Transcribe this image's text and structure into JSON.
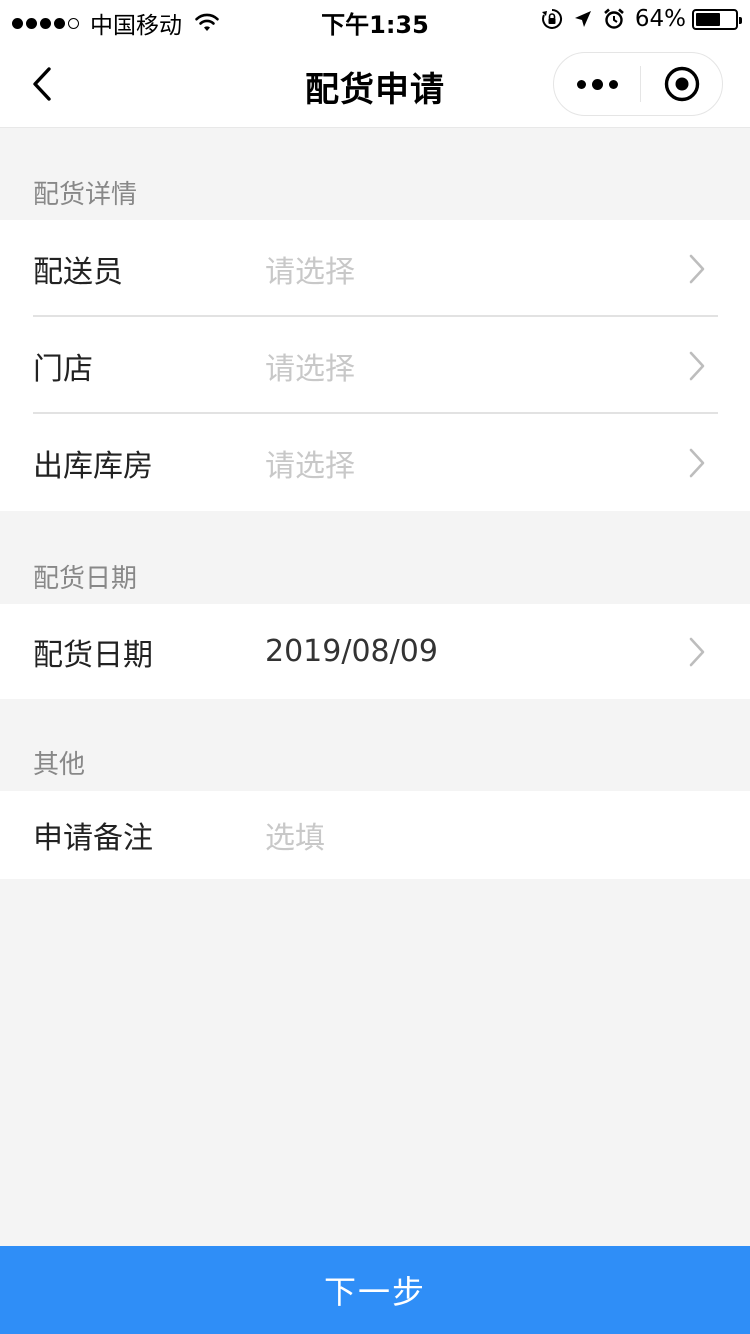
{
  "status_bar": {
    "carrier": "中国移动",
    "time": "下午1:35",
    "battery_percent": "64%",
    "battery_level": 0.64,
    "icons": [
      "signal-icon",
      "wifi-icon",
      "rotation-lock-icon",
      "location-icon",
      "alarm-icon",
      "battery-icon"
    ]
  },
  "nav": {
    "title": "配货申请",
    "back_icon": "chevron-left-icon",
    "more_icon": "more-icon",
    "close_icon": "target-circle-icon"
  },
  "sections": {
    "details": {
      "title": "配货详情",
      "rows": [
        {
          "label": "配送员",
          "value": "请选择"
        },
        {
          "label": "门店",
          "value": "请选择"
        },
        {
          "label": "出库库房",
          "value": "请选择"
        }
      ]
    },
    "date": {
      "title": "配货日期",
      "rows": [
        {
          "label": "配货日期",
          "value": "2019/08/09"
        }
      ]
    },
    "other": {
      "title": "其他",
      "rows": [
        {
          "label": "申请备注",
          "placeholder": "选填"
        }
      ]
    }
  },
  "footer": {
    "next_label": "下一步"
  },
  "colors": {
    "accent": "#2f8ef7",
    "background": "#f4f4f4",
    "placeholder": "#c8c8c8",
    "section_title": "#888888"
  }
}
